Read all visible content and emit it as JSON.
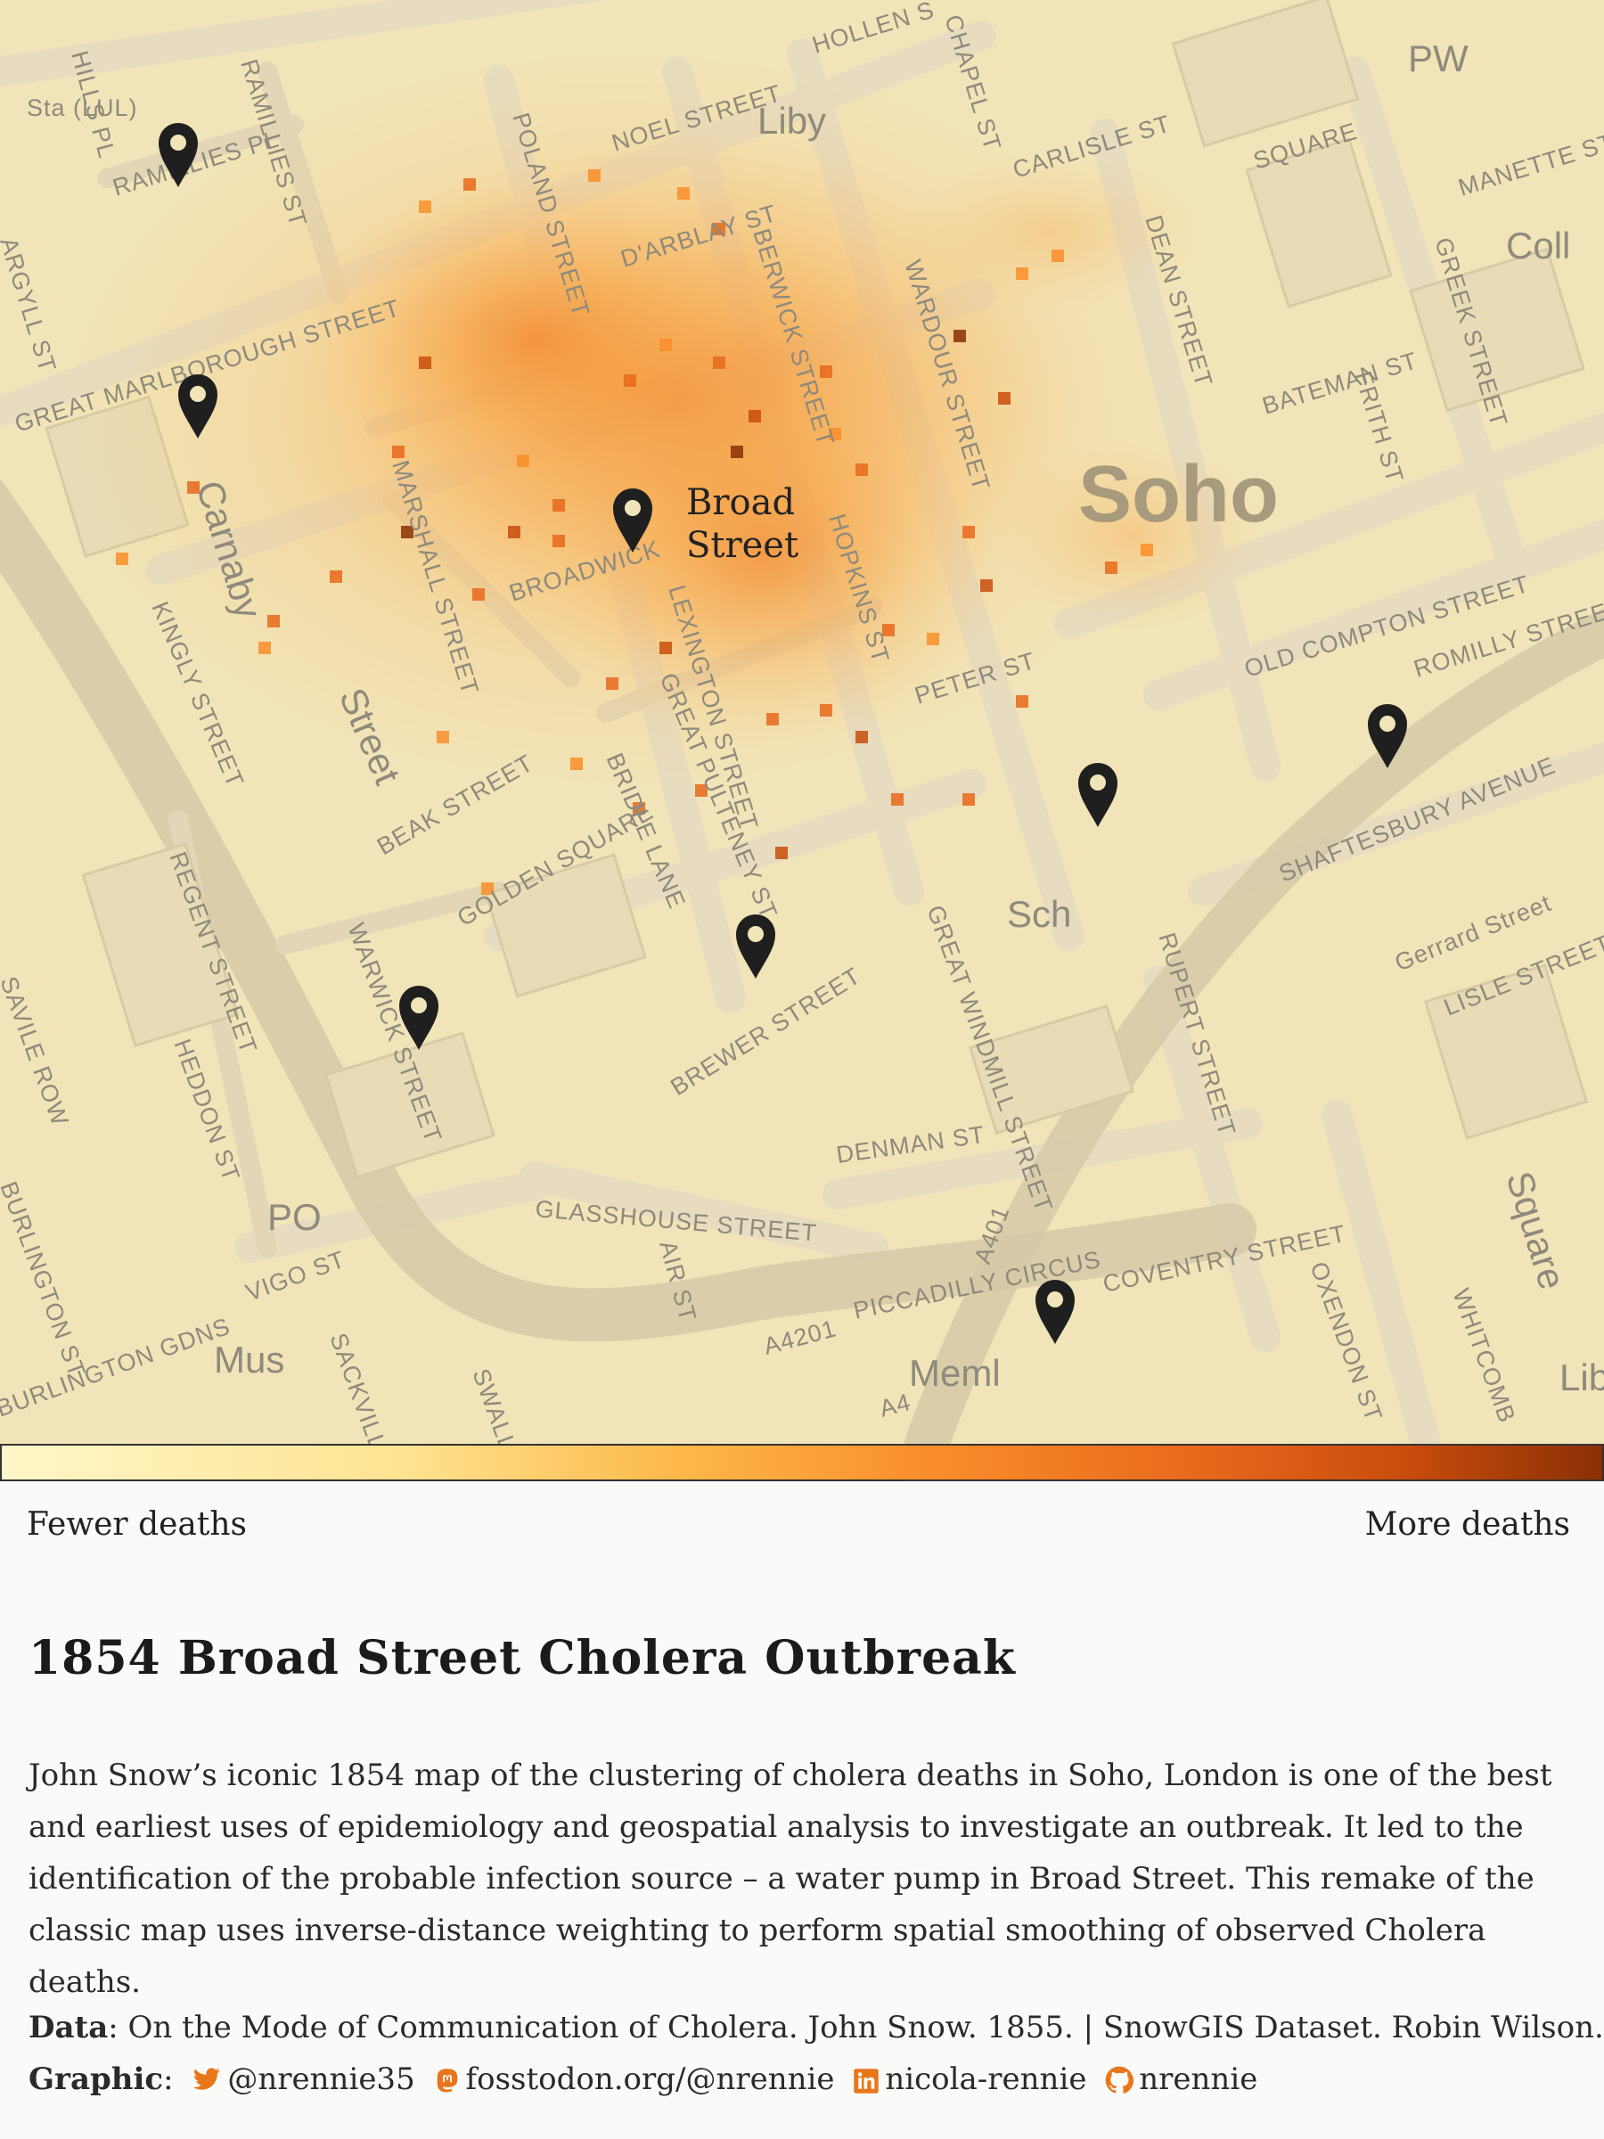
{
  "map": {
    "pump_label": "Broad Street",
    "area_label": "Soho",
    "street_labels": [
      "Sta (LUL)",
      "HILLS PL",
      "RAMILLIES PL",
      "RAMILLIES ST",
      "POLAND STREET",
      "NOEL STREET",
      "Liby",
      "D'ARBLAY ST",
      "BERWICK STREET",
      "WARDOUR STREET",
      "HOLLEN S",
      "CHAPEL ST",
      "CARLISLE ST",
      "SQUARE",
      "MANETTE ST",
      "Coll",
      "PW",
      "GREEK STREET",
      "DEAN STREET",
      "BATEMAN ST",
      "FRITH ST",
      "ARGYLL ST",
      "GREAT MARLBOROUGH STREET",
      "Carnaby",
      "MARSHALL STREET",
      "BROADWICK",
      "LEXINGTON STREET",
      "HOPKINS ST",
      "PETER ST",
      "OLD COMPTON STREET",
      "ROMILLY STREET",
      "KINGLY STREET",
      "Street",
      "BEAK STREET",
      "GREAT PULTENEY ST",
      "BRIDLE LANE",
      "SHAFTESBURY AVENUE",
      "Gerrard Street",
      "LISLE STREET",
      "REGENT STREET",
      "GOLDEN SQUARE",
      "WARWICK STREET",
      "BREWER STREET",
      "Sch",
      "GREAT WINDMILL STREET",
      "RUPERT STREET",
      "SAVILE ROW",
      "HEDDON ST",
      "PO",
      "DENMAN ST",
      "GLASSHOUSE STREET",
      "AIR ST",
      "VIGO ST",
      "PICCADILLY CIRCUS",
      "A4201",
      "A4",
      "A401",
      "COVENTRY STREET",
      "OXENDON ST",
      "WHITCOMB",
      "Square",
      "Mus",
      "SACKVILLE",
      "SWALLOW",
      "Meml",
      "BURLINGTON ST",
      "BURLINGTON GDNS",
      "Lib"
    ]
  },
  "legend": {
    "low_label": "Fewer deaths",
    "high_label": "More deaths",
    "colors": [
      "#fff7c9",
      "#fee391",
      "#fdb94a",
      "#f98e2a",
      "#e8681b",
      "#c84c0c",
      "#8a3005"
    ]
  },
  "title": "1854 Broad Street Cholera Outbreak",
  "description": "John Snow’s iconic 1854 map of the clustering of cholera deaths in Soho, London is one of the best and earliest uses of epidemiology and geospatial analysis to investigate an outbreak. It led to the identification of the probable infection source – a water pump in Broad Street. This remake of the classic map uses inverse-distance weighting to perform spatial smoothing of observed Cholera deaths.",
  "credits": {
    "data_label": "Data",
    "data_text": ": On the Mode of Communication of Cholera. John Snow. 1855. | SnowGIS Dataset. Robin Wilson.",
    "graphic_label": "Graphic",
    "twitter": "@nrennie35",
    "mastodon": "fosstodon.org/@nrennie",
    "linkedin": "nicola-rennie",
    "github": "nrennie",
    "icon_names": [
      "twitter-icon",
      "mastodon-icon",
      "linkedin-icon",
      "github-icon"
    ],
    "icon_color": "#e8761b"
  },
  "pumps": {
    "count": 8,
    "marker_color": "#1f1f1f"
  }
}
